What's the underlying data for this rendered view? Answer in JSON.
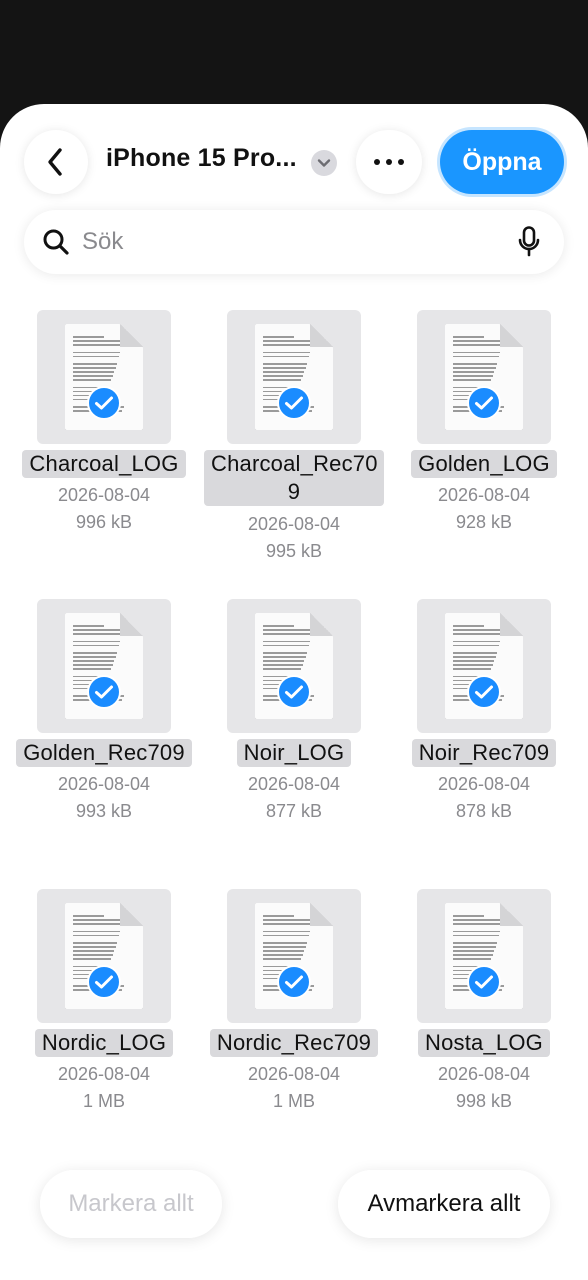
{
  "header": {
    "title": "iPhone 15 Pro...",
    "open_label": "Öppna"
  },
  "search": {
    "placeholder": "Sök"
  },
  "files": [
    {
      "name": "Charcoal_LOG",
      "date": "2026-08-04",
      "size": "996 kB"
    },
    {
      "name": "Charcoal_Rec709",
      "name_line1": "Charcoal_Rec70",
      "name_line2": "9",
      "date": "2026-08-04",
      "size": "995 kB"
    },
    {
      "name": "Golden_LOG",
      "date": "2026-08-04",
      "size": "928 kB"
    },
    {
      "name": "Golden_Rec709",
      "date": "2026-08-04",
      "size": "993 kB"
    },
    {
      "name": "Noir_LOG",
      "date": "2026-08-04",
      "size": "877 kB"
    },
    {
      "name": "Noir_Rec709",
      "date": "2026-08-04",
      "size": "878 kB"
    },
    {
      "name": "Nordic_LOG",
      "date": "2026-08-04",
      "size": "1 MB"
    },
    {
      "name": "Nordic_Rec709",
      "date": "2026-08-04",
      "size": "1 MB"
    },
    {
      "name": "Nosta_LOG",
      "date": "2026-08-04",
      "size": "998 kB"
    }
  ],
  "bottom": {
    "select_all_label": "Markera allt",
    "deselect_all_label": "Avmarkera allt"
  },
  "colors": {
    "accent": "#1a96ff",
    "check": "#1a8cff"
  },
  "icons": [
    "chevron-left-icon",
    "chevron-down-icon",
    "more-icon",
    "search-icon",
    "microphone-icon",
    "document-icon",
    "checkmark-icon"
  ]
}
